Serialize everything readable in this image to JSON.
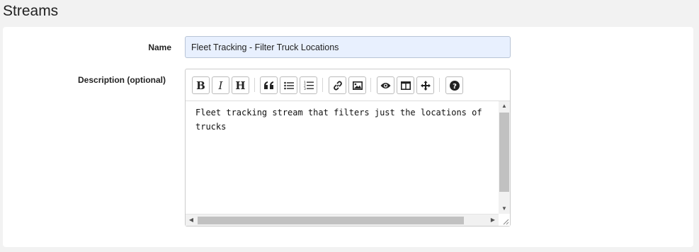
{
  "page": {
    "title": "Streams"
  },
  "form": {
    "name_label": "Name",
    "name_value": "Fleet Tracking - Filter Truck Locations",
    "description_label": "Description (optional)",
    "description_value": "Fleet tracking stream that filters just the locations of\ntrucks"
  },
  "toolbar": {
    "bold": "B",
    "italic": "I",
    "heading": "H",
    "icons": [
      "bold-icon",
      "italic-icon",
      "heading-icon",
      "quote-icon",
      "unordered-list-icon",
      "ordered-list-icon",
      "link-icon",
      "image-icon",
      "preview-icon",
      "side-by-side-icon",
      "fullscreen-icon",
      "help-icon"
    ]
  }
}
